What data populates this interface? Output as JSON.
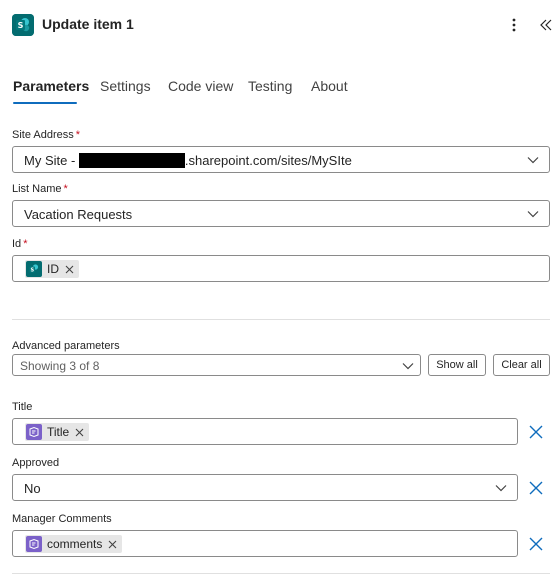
{
  "header": {
    "title": "Update item 1",
    "app_icon": "sharepoint-icon",
    "more_icon": "more-vertical-icon",
    "collapse_icon": "double-chevron-left-icon"
  },
  "tabs": [
    {
      "label": "Parameters",
      "active": true
    },
    {
      "label": "Settings",
      "active": false
    },
    {
      "label": "Code view",
      "active": false
    },
    {
      "label": "Testing",
      "active": false
    },
    {
      "label": "About",
      "active": false
    }
  ],
  "fields": {
    "site_address": {
      "label": "Site Address",
      "required_mark": "*",
      "value_prefix": "My Site - ",
      "value_suffix": ".sharepoint.com/sites/MySIte"
    },
    "list_name": {
      "label": "List Name",
      "required_mark": "*",
      "value": "Vacation Requests"
    },
    "id": {
      "label": "Id",
      "required_mark": "*",
      "token": "ID"
    }
  },
  "advanced": {
    "label": "Advanced parameters",
    "showing": "Showing 3 of 8",
    "show_all": "Show all",
    "clear_all": "Clear all"
  },
  "adv_fields": {
    "title": {
      "label": "Title",
      "token": "Title"
    },
    "approved": {
      "label": "Approved",
      "value": "No"
    },
    "manager_comments": {
      "label": "Manager Comments",
      "token": "comments"
    }
  },
  "colors": {
    "accent": "#0f6cbd",
    "sharepoint": "#036c70",
    "forms": "#7b61c9",
    "required": "#c50f1f",
    "remove_x": "#0f6cbd"
  }
}
